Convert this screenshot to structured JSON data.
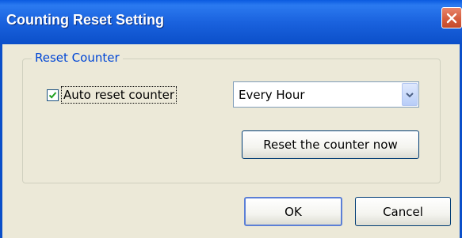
{
  "window": {
    "title": "Counting Reset Setting",
    "close_icon": "close-icon"
  },
  "group": {
    "label": "Reset Counter"
  },
  "auto_reset": {
    "label": "Auto reset counter",
    "checked": true
  },
  "interval_select": {
    "value": "Every Hour"
  },
  "buttons": {
    "reset_now": "Reset the counter now",
    "ok": "OK",
    "cancel": "Cancel"
  },
  "colors": {
    "titlebar": "#0b4fc9",
    "group_label": "#0046d5",
    "close_button": "#d45a3a"
  }
}
